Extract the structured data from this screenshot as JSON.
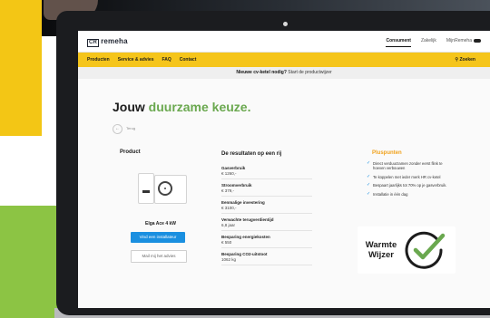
{
  "header": {
    "logo_text": "remeha",
    "logo_mark": "CR",
    "top_links": [
      "Consument",
      "Zakelijk",
      "MijnRemeha"
    ]
  },
  "nav": {
    "items": [
      "Producten",
      "Service & advies",
      "FAQ",
      "Contact"
    ],
    "search_label": "Zoeken",
    "accent_color": "#f5c51b"
  },
  "banner": {
    "question": "Nieuwe cv-ketel nodig?",
    "cta": "Start de productwijzer"
  },
  "hero": {
    "title_prefix": "Jouw",
    "title_highlight": "duurzame keuze.",
    "back_label": "Terug"
  },
  "product": {
    "heading": "Product",
    "name": "Elga Ace 4 kW",
    "primary_button": "Vind een installateur",
    "secondary_button": "Mail mij het advies",
    "link": ""
  },
  "results": {
    "heading": "De resultaten op een rij",
    "items": [
      {
        "label": "Gasverbruik",
        "value": "€ 1260,-"
      },
      {
        "label": "Stroomverbruik",
        "value": "€ 379,-"
      },
      {
        "label": "Eenmalige investering",
        "value": "€ 3100,-"
      },
      {
        "label": "Verwachte terugverdientijd",
        "value": "6,8 jaar"
      },
      {
        "label": "Besparing energiekosten",
        "value": "€ 550"
      },
      {
        "label": "Besparing CO2-uitstoot",
        "value": "1062 kg"
      }
    ]
  },
  "pluspunten": {
    "heading": "Pluspunten",
    "items": [
      "Direct verduurzamen zonder eerst flink te hoeven verbouwen",
      "Te koppelen met ieder merk HR cv-ketel",
      "Bespaart jaarlijks tot 70% op je gasverbruik.",
      "Installatie in één dag"
    ]
  },
  "badge": {
    "line1": "Warmte",
    "line2": "Wijzer",
    "check_color": "#6aa84f"
  }
}
